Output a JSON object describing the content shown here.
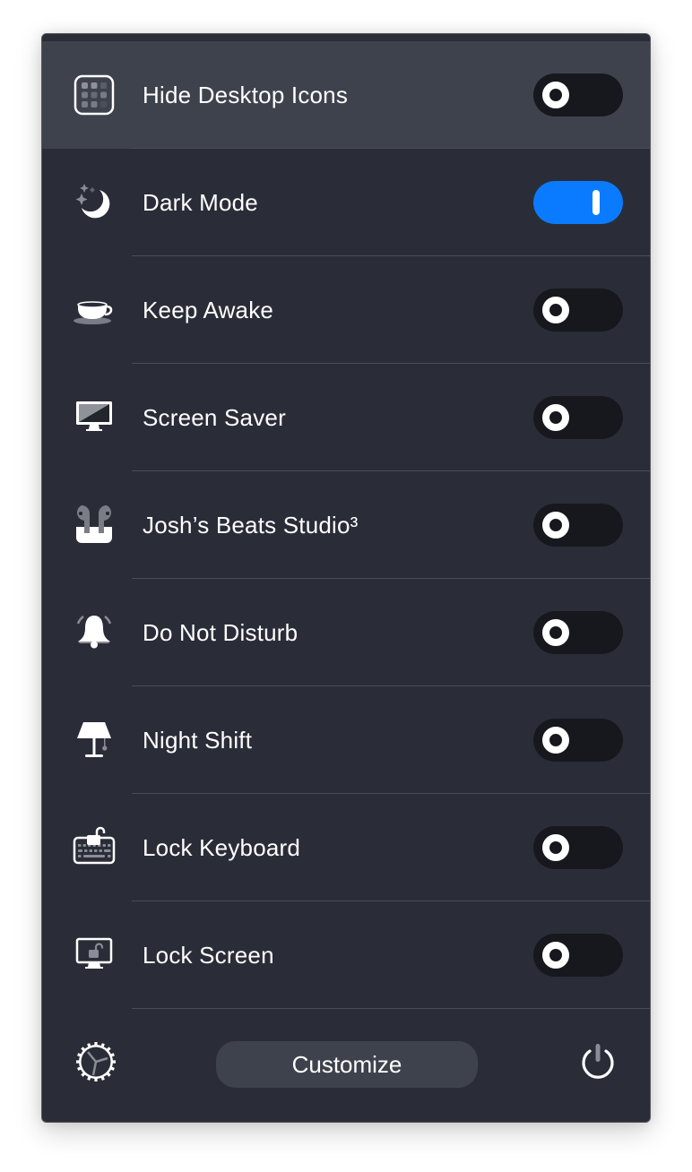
{
  "colors": {
    "window_bg": "#2a2d38",
    "highlight_bg": "#3e424d",
    "toggle_off": "#17181d",
    "toggle_on": "#0a7bff",
    "text": "#ffffff"
  },
  "items": [
    {
      "label": "Hide Desktop Icons",
      "icon": "desktop-icons-grid-icon",
      "on": false,
      "highlighted": true
    },
    {
      "label": "Dark Mode",
      "icon": "moon-stars-icon",
      "on": true,
      "highlighted": false
    },
    {
      "label": "Keep Awake",
      "icon": "coffee-cup-icon",
      "on": false,
      "highlighted": false
    },
    {
      "label": "Screen Saver",
      "icon": "monitor-icon",
      "on": false,
      "highlighted": false
    },
    {
      "label": "Josh’s Beats Studio³",
      "icon": "earbuds-icon",
      "on": false,
      "highlighted": false
    },
    {
      "label": "Do Not Disturb",
      "icon": "bell-icon",
      "on": false,
      "highlighted": false
    },
    {
      "label": "Night Shift",
      "icon": "lamp-icon",
      "on": false,
      "highlighted": false
    },
    {
      "label": "Lock Keyboard",
      "icon": "keyboard-lock-icon",
      "on": false,
      "highlighted": false
    },
    {
      "label": "Lock Screen",
      "icon": "screen-lock-icon",
      "on": false,
      "highlighted": false
    }
  ],
  "footer": {
    "customize_label": "Customize",
    "settings_icon": "gear-icon",
    "quit_icon": "power-icon"
  }
}
